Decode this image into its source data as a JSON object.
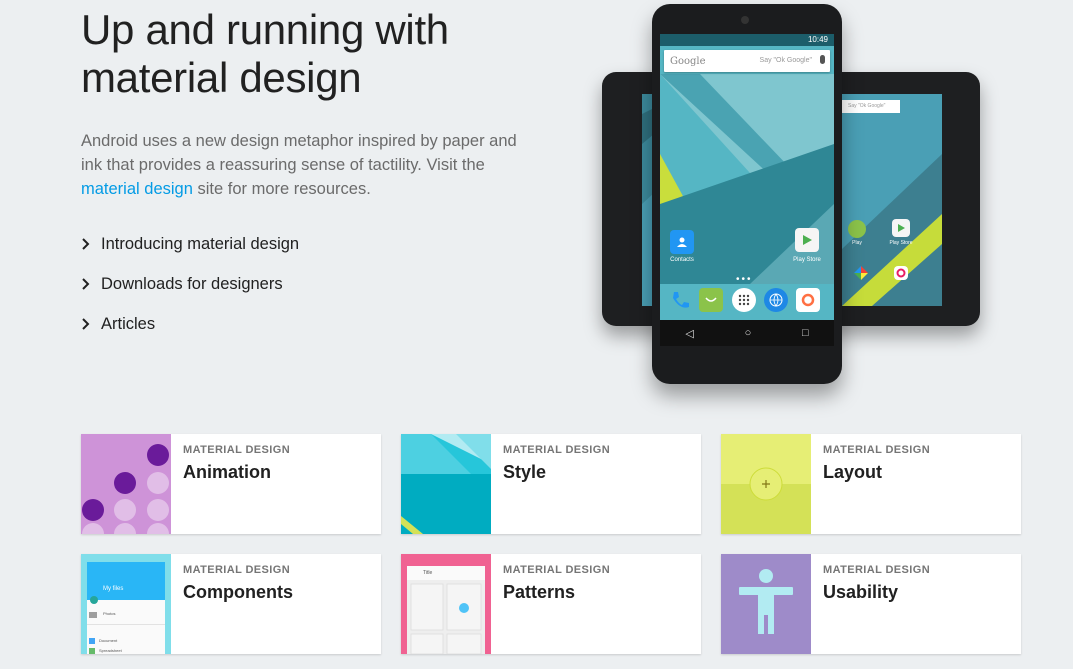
{
  "hero": {
    "title_line1": "Up and running with",
    "title_line2": "material design",
    "desc_before": "Android uses a new design metaphor inspired by paper and ink that provides a reassuring sense of tactility. Visit the ",
    "desc_link": "material design",
    "desc_after": " site for more resources.",
    "link_color": "#039be5"
  },
  "links": [
    {
      "label": "Introducing material design",
      "icon": "chevron-right-icon"
    },
    {
      "label": "Downloads for designers",
      "icon": "chevron-right-icon"
    },
    {
      "label": "Articles",
      "icon": "chevron-right-icon"
    }
  ],
  "device": {
    "time": "10:49",
    "search_brand": "Google",
    "search_hint": "Say \"Ok Google\"",
    "app_contacts": "Contacts",
    "app_playstore": "Play Store",
    "tablet_search_hint": "Say \"Ok Google\"",
    "tablet_app_play": "Play",
    "tablet_app_playstore": "Play Store"
  },
  "cards": [
    {
      "eyebrow": "MATERIAL DESIGN",
      "title": "Animation",
      "thumb_color": "#ce93d8"
    },
    {
      "eyebrow": "MATERIAL DESIGN",
      "title": "Style",
      "thumb_color": "#4dd0e1"
    },
    {
      "eyebrow": "MATERIAL DESIGN",
      "title": "Layout",
      "thumb_color": "#e6ee75"
    },
    {
      "eyebrow": "MATERIAL DESIGN",
      "title": "Components",
      "thumb_color": "#80deea",
      "thumb_app_title": "My files",
      "thumb_row1": "Photos",
      "thumb_row2": "Document",
      "thumb_row3": "Spreadsheet"
    },
    {
      "eyebrow": "MATERIAL DESIGN",
      "title": "Patterns",
      "thumb_color": "#f06292",
      "thumb_app_title": "Title"
    },
    {
      "eyebrow": "MATERIAL DESIGN",
      "title": "Usability",
      "thumb_color": "#9e8bc9"
    }
  ]
}
